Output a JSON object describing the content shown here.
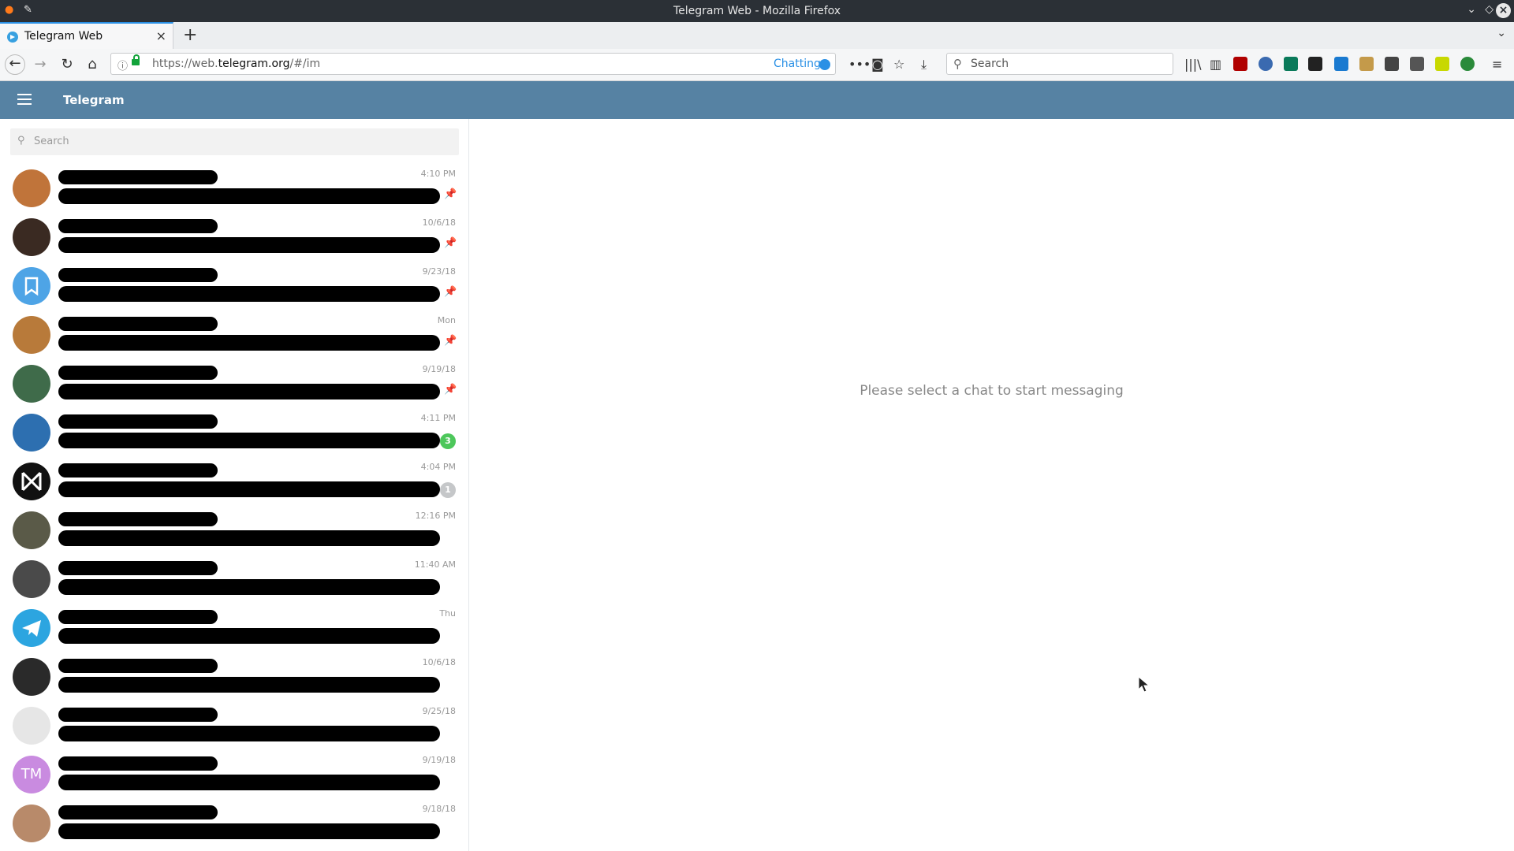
{
  "window": {
    "title": "Telegram Web - Mozilla Firefox"
  },
  "tab": {
    "label": "Telegram Web"
  },
  "address_bar": {
    "url_prefix": "https://web.",
    "url_domain": "telegram.org",
    "url_suffix": "/#/im",
    "page_action": "Chatting"
  },
  "browser_search": {
    "placeholder": "Search"
  },
  "telegram": {
    "brand": "Telegram",
    "search_placeholder": "Search",
    "empty_state": "Please select a chat to start messaging"
  },
  "chats": [
    {
      "time": "4:10 PM",
      "pinned": true,
      "avatar": "photo",
      "avatar_color": "#c0743a"
    },
    {
      "time": "10/6/18",
      "pinned": true,
      "avatar": "photo",
      "avatar_color": "#3a2a22"
    },
    {
      "time": "9/23/18",
      "pinned": true,
      "avatar": "saved-messages",
      "avatar_color": "#4ea4e6"
    },
    {
      "time": "Mon",
      "pinned": true,
      "avatar": "photo",
      "avatar_color": "#b87a3a"
    },
    {
      "time": "9/19/18",
      "pinned": true,
      "avatar": "photo",
      "avatar_color": "#3f6b4a"
    },
    {
      "time": "4:11 PM",
      "badge": "3",
      "badge_color": "#4dc75b",
      "avatar": "photo",
      "avatar_color": "#2d6fb0"
    },
    {
      "time": "4:04 PM",
      "badge": "1",
      "badge_color": "#c5c7c9",
      "avatar": "logo",
      "avatar_color": "#111111"
    },
    {
      "time": "12:16 PM",
      "avatar": "photo",
      "avatar_color": "#5a5a48"
    },
    {
      "time": "11:40 AM",
      "avatar": "photo",
      "avatar_color": "#4a4a4a"
    },
    {
      "time": "Thu",
      "avatar": "telegram-logo",
      "avatar_color": "#2ca5e0"
    },
    {
      "time": "10/6/18",
      "avatar": "photo",
      "avatar_color": "#2a2a2a"
    },
    {
      "time": "9/25/18",
      "avatar": "photo",
      "avatar_color": "#e6e6e6"
    },
    {
      "time": "9/19/18",
      "avatar": "initials",
      "initials": "TM",
      "avatar_color": "#c98be0"
    },
    {
      "time": "9/18/18",
      "avatar": "photo",
      "avatar_color": "#b88a6a"
    }
  ]
}
